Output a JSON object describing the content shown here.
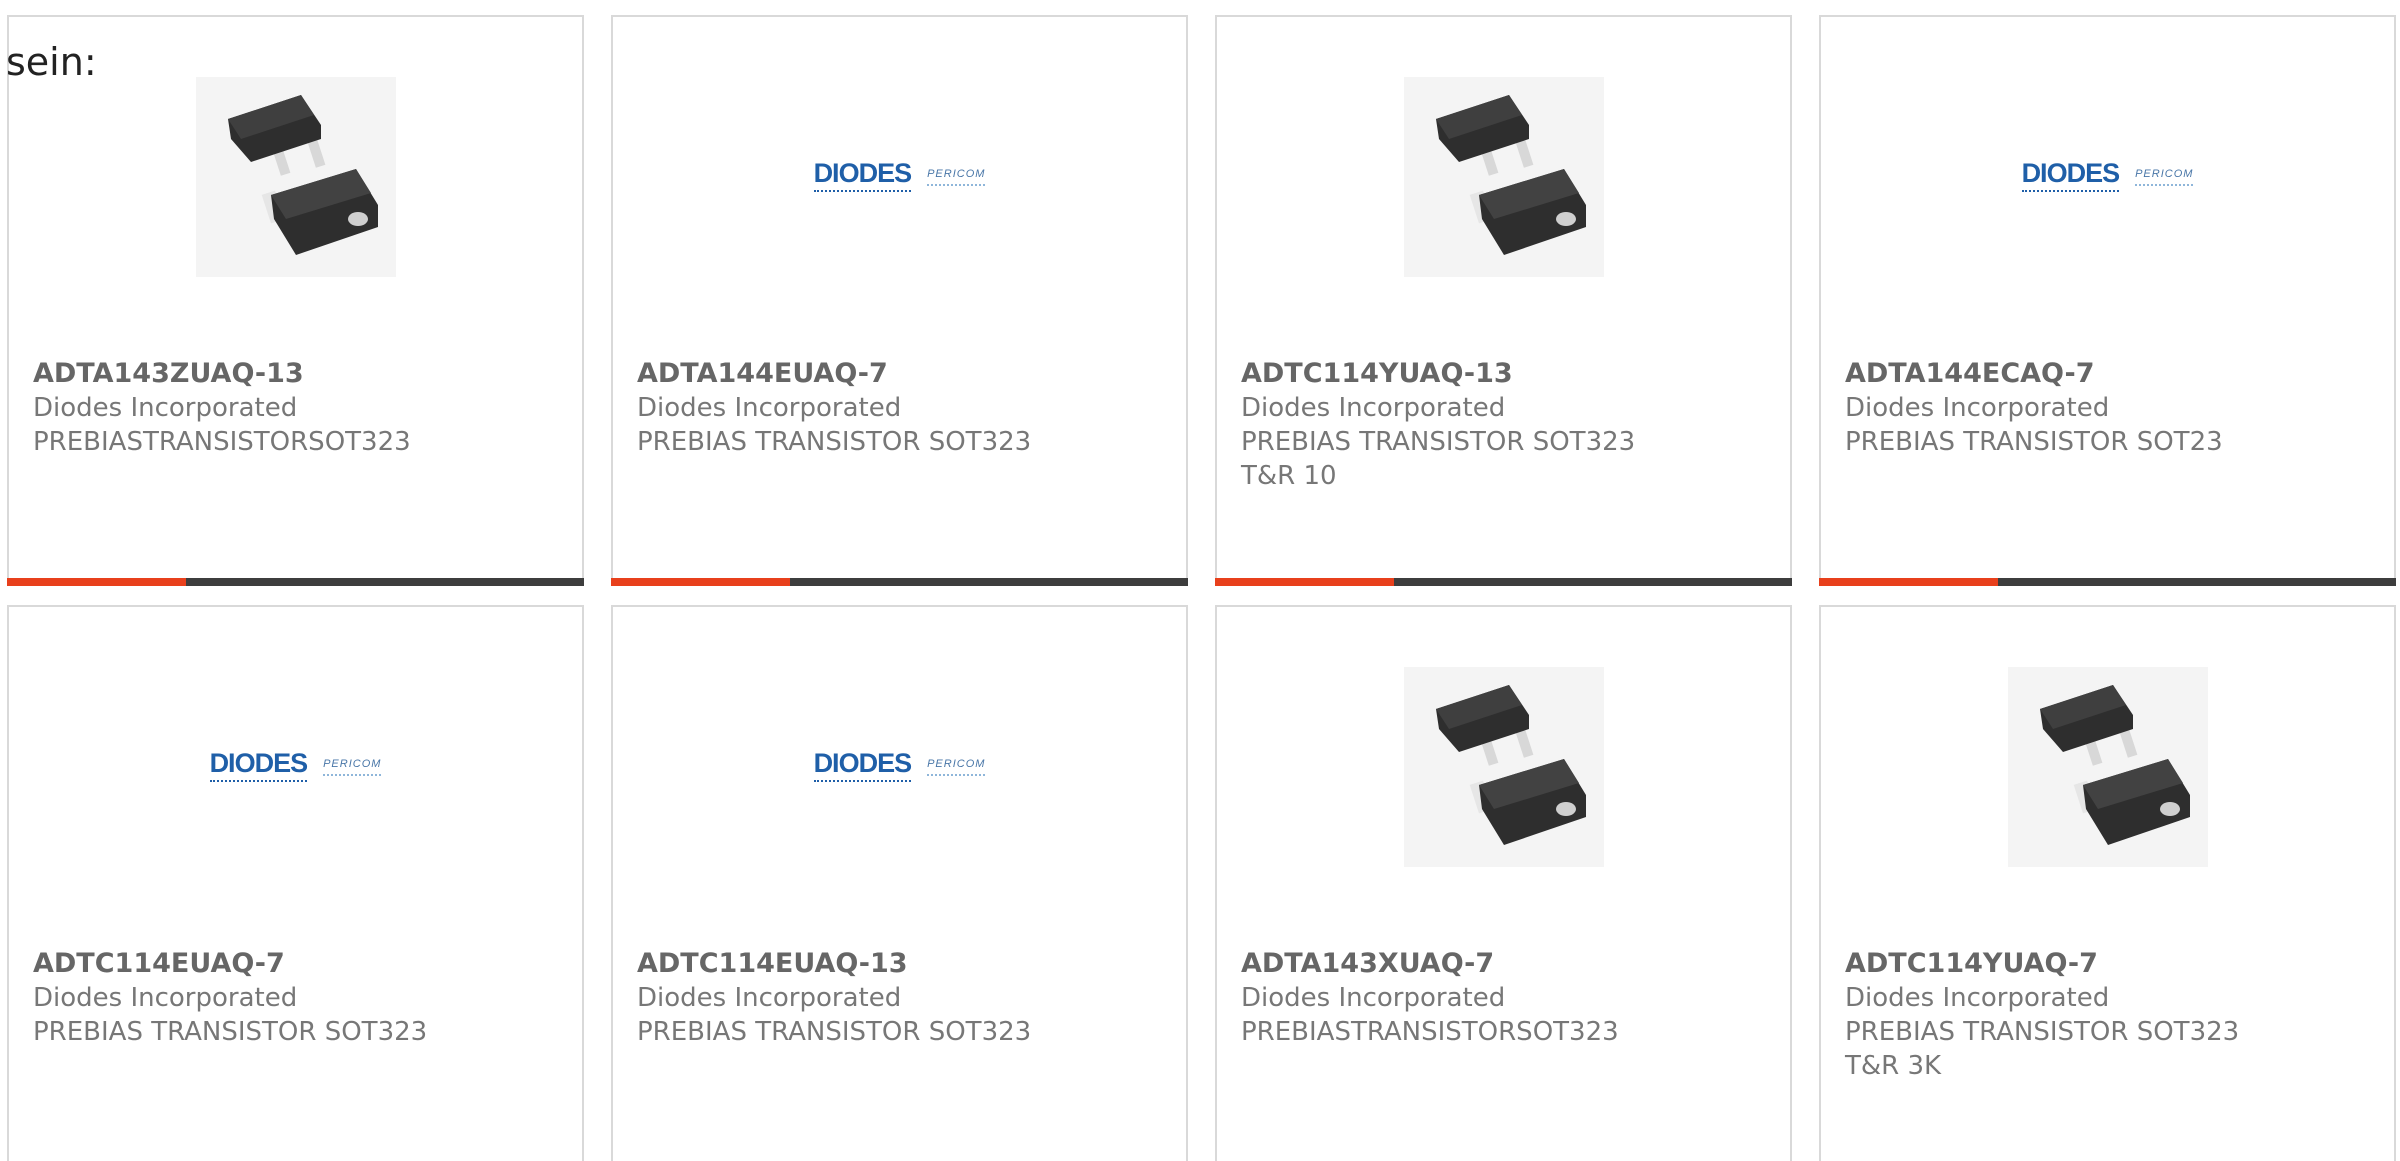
{
  "intro_text": "sein:",
  "accent_color": "#e8401c",
  "track_color": "#3d3d3d",
  "cards": [
    {
      "part": "ADTA143ZUAQ-13",
      "manufacturer": "Diodes Incorporated",
      "desc": "PREBIASTRANSISTORSOT323",
      "desc2": "",
      "image": "sot323-chip-image"
    },
    {
      "part": "ADTA144EUAQ-7",
      "manufacturer": "Diodes Incorporated",
      "desc": "PREBIAS TRANSISTOR SOT323",
      "desc2": "",
      "image": "diodes-pericom-logo",
      "logo_brand": "DIODES",
      "logo_sub": "PERICOM"
    },
    {
      "part": "ADTC114YUAQ-13",
      "manufacturer": "Diodes Incorporated",
      "desc": "PREBIAS TRANSISTOR SOT323",
      "desc2": "T&R 10",
      "image": "sot323-chip-image"
    },
    {
      "part": "ADTA144ECAQ-7",
      "manufacturer": "Diodes Incorporated",
      "desc": "PREBIAS TRANSISTOR SOT23",
      "desc2": "",
      "image": "diodes-pericom-logo",
      "logo_brand": "DIODES",
      "logo_sub": "PERICOM"
    },
    {
      "part": "ADTC114EUAQ-7",
      "manufacturer": "Diodes Incorporated",
      "desc": "PREBIAS TRANSISTOR SOT323",
      "desc2": "",
      "image": "diodes-pericom-logo",
      "logo_brand": "DIODES",
      "logo_sub": "PERICOM"
    },
    {
      "part": "ADTC114EUAQ-13",
      "manufacturer": "Diodes Incorporated",
      "desc": "PREBIAS TRANSISTOR SOT323",
      "desc2": "",
      "image": "diodes-pericom-logo",
      "logo_brand": "DIODES",
      "logo_sub": "PERICOM"
    },
    {
      "part": "ADTA143XUAQ-7",
      "manufacturer": "Diodes Incorporated",
      "desc": "PREBIASTRANSISTORSOT323",
      "desc2": "",
      "image": "sot323-chip-image"
    },
    {
      "part": "ADTC114YUAQ-7",
      "manufacturer": "Diodes Incorporated",
      "desc": "PREBIAS TRANSISTOR SOT323",
      "desc2": "T&R 3K",
      "image": "sot323-chip-image"
    }
  ],
  "progress_fraction": 0.31
}
